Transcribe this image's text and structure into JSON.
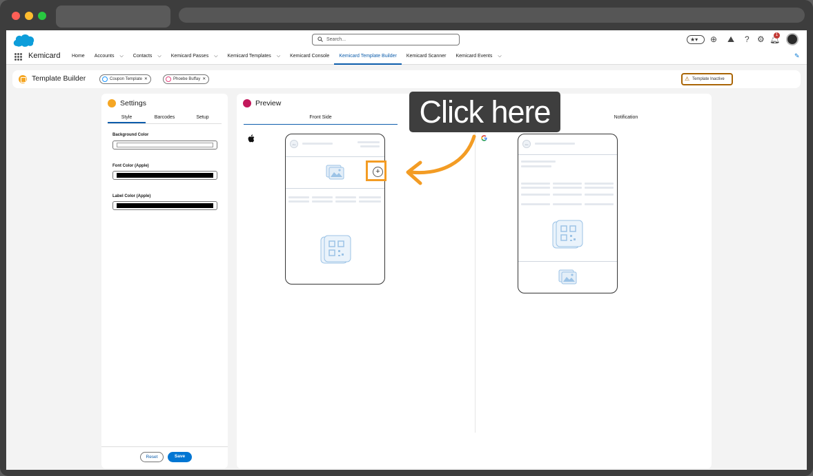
{
  "header": {
    "search_placeholder": "Search...",
    "notification_count": "1",
    "favorites_glyph": "★▾"
  },
  "app": {
    "name": "Kemicard",
    "nav": [
      {
        "label": "Home",
        "dropdown": false,
        "active": false
      },
      {
        "label": "Accounts",
        "dropdown": true,
        "active": false
      },
      {
        "label": "Contacts",
        "dropdown": true,
        "active": false
      },
      {
        "label": "Kemicard Passes",
        "dropdown": true,
        "active": false
      },
      {
        "label": "Kemicard Templates",
        "dropdown": true,
        "active": false
      },
      {
        "label": "Kemicard Console",
        "dropdown": false,
        "active": false
      },
      {
        "label": "Kemicard Template Builder",
        "dropdown": false,
        "active": true
      },
      {
        "label": "Kemicard Scanner",
        "dropdown": false,
        "active": false
      },
      {
        "label": "Kemicard Events",
        "dropdown": true,
        "active": false
      }
    ]
  },
  "builder": {
    "title": "Template Builder",
    "template_pill": "Coupon Template",
    "contact_pill": "Phoebe Buffay",
    "status": "Template Inactive"
  },
  "settings": {
    "title": "Settings",
    "tabs": [
      "Style",
      "Barcodes",
      "Setup"
    ],
    "fields": {
      "background_label": "Background Color",
      "font_label": "Font Color (Apple)",
      "label_label": "Label Color (Apple)"
    },
    "reset_label": "Reset",
    "save_label": "Save"
  },
  "preview": {
    "title": "Preview",
    "tab_front": "Front Side",
    "tab_notification": "Notification"
  },
  "callout": {
    "text": "Click here"
  },
  "colors": {
    "accent": "#0b5cab",
    "callout_orange": "#f39c24",
    "settings_icon": "#f5a623",
    "preview_icon": "#c2185b",
    "field_background": "#ffffff",
    "field_font": "#000000",
    "field_label": "#000000"
  }
}
